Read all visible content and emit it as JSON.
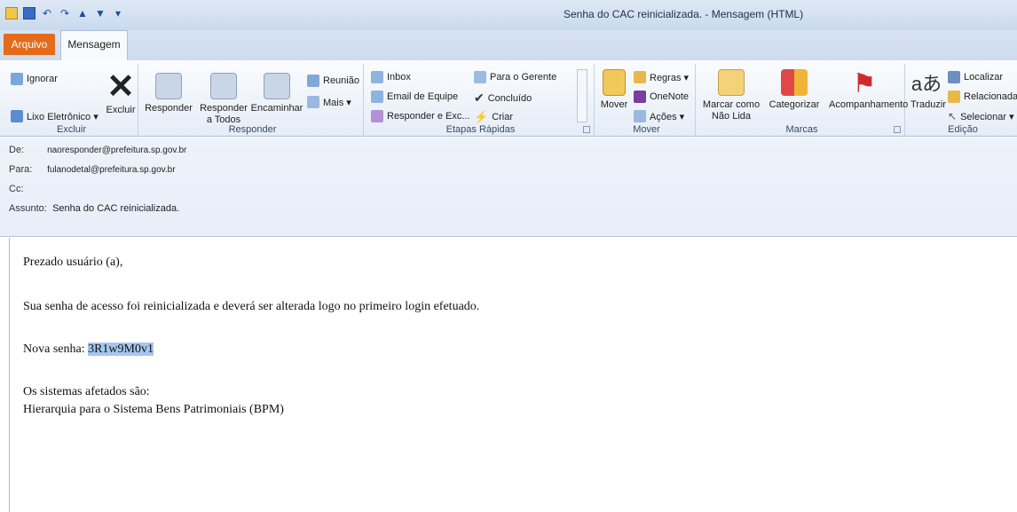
{
  "window": {
    "title": "Senha do CAC reinicializada. - Mensagem (HTML)"
  },
  "tabs": {
    "arquivo": "Arquivo",
    "mensagem": "Mensagem"
  },
  "ribbon": {
    "excluir": {
      "ignorar": "Ignorar",
      "lixo": "Lixo Eletrônico ▾",
      "excluir": "Excluir",
      "group": "Excluir"
    },
    "responder": {
      "responder": "Responder",
      "responder_todos": "Responder a Todos",
      "encaminhar": "Encaminhar",
      "reuniao": "Reunião",
      "mais": "Mais ▾",
      "group": "Responder"
    },
    "etapas": {
      "inbox": "Inbox",
      "email_equipe": "Email de Equipe",
      "responder_exc": "Responder e Exc...",
      "para_gerente": "Para o Gerente",
      "concluido": "Concluído",
      "criar": "Criar",
      "group": "Etapas Rápidas"
    },
    "mover": {
      "mover": "Mover",
      "regras": "Regras ▾",
      "onenote": "OneNote",
      "acoes": "Ações ▾",
      "group": "Mover"
    },
    "marcas": {
      "marcar": "Marcar como Não Lida",
      "categorizar": "Categorizar",
      "acompanhamento": "Acompanhamento",
      "group": "Marcas"
    },
    "edicao": {
      "traduzir": "Traduzir",
      "localizar": "Localizar",
      "relacionada": "Relacionada",
      "selecionar": "Selecionar ▾",
      "group": "Edição"
    }
  },
  "headers": {
    "de_label": "De:",
    "de": "naoresponder@prefeitura.sp.gov.br",
    "para_label": "Para:",
    "para": "fulanodetal@prefeitura.sp.gov.br",
    "cc_label": "Cc:",
    "assunto_label": "Assunto:",
    "assunto": "Senha do CAC reinicializada."
  },
  "message": {
    "greeting": "Prezado usuário (a),",
    "line1": "Sua senha de acesso foi reinicializada e deverá ser alterada logo no primeiro login efetuado.",
    "senha_label": "Nova senha:",
    "senha": "3R1w9M0v1",
    "sistemas": "Os sistemas afetados são:",
    "sistema1": "Hierarquia para o Sistema Bens Patrimoniais (BPM)"
  }
}
